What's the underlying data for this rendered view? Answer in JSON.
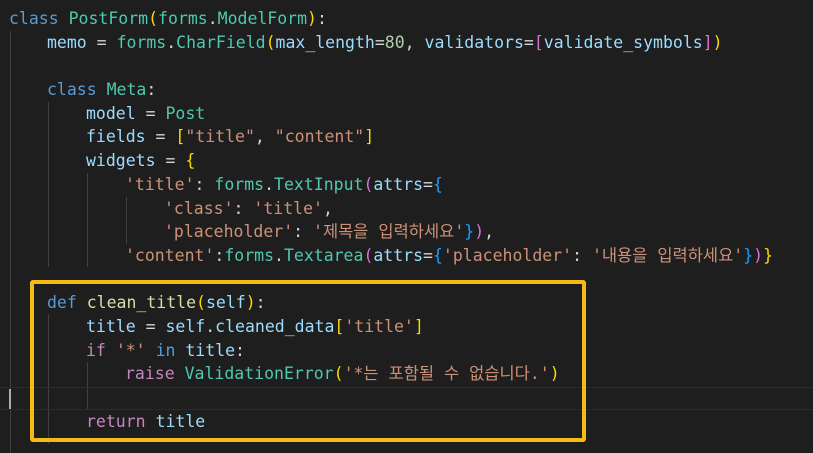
{
  "code": {
    "l1": {
      "kw": "class",
      "cls": "PostForm",
      "p1": "(",
      "mod": "forms",
      "dot": ".",
      "base": "ModelForm",
      "p2": ")",
      "colon": ":"
    },
    "l2": {
      "var": "memo",
      "eq": " = ",
      "mod": "forms",
      "dot": ".",
      "cls": "CharField",
      "p1": "(",
      "arg1": "max_length",
      "eq2": "=",
      "num": "80",
      "comma": ", ",
      "arg2": "validators",
      "eq3": "=",
      "b1": "[",
      "fn": "validate_symbols",
      "b2": "]",
      "p2": ")"
    },
    "l3": {
      "kw": "class",
      "cls": "Meta",
      "colon": ":"
    },
    "l4": {
      "var": "model",
      "eq": " = ",
      "cls": "Post"
    },
    "l5": {
      "var": "fields",
      "eq": " = ",
      "b1": "[",
      "s1": "\"title\"",
      "comma": ", ",
      "s2": "\"content\"",
      "b2": "]"
    },
    "l6": {
      "var": "widgets",
      "eq": " = ",
      "b1": "{"
    },
    "l7": {
      "s1": "'title'",
      "colon": ": ",
      "mod": "forms",
      "dot": ".",
      "cls": "TextInput",
      "p1": "(",
      "arg": "attrs",
      "eq": "=",
      "b1": "{"
    },
    "l8": {
      "s1": "'class'",
      "colon": ": ",
      "s2": "'title'",
      "comma": ","
    },
    "l9": {
      "s1": "'placeholder'",
      "colon": ": ",
      "s2": "'제목을 입력하세요'",
      "b1": "}",
      "p1": ")",
      "comma": ","
    },
    "l10": {
      "s1": "'content'",
      "colon": ":",
      "mod": "forms",
      "dot": ".",
      "cls": "Textarea",
      "p1": "(",
      "arg": "attrs",
      "eq": "=",
      "b1": "{",
      "s2": "'placeholder'",
      "colon2": ": ",
      "s3": "'내용을 입력하세요'",
      "b2": "}",
      "p2": ")",
      "b3": "}"
    },
    "l11": {
      "kw": "def",
      "fn": "clean_title",
      "p1": "(",
      "var": "self",
      "p2": ")",
      "colon": ":"
    },
    "l12": {
      "var": "title",
      "eq": " = ",
      "var2": "self",
      "dot": ".",
      "attr": "cleaned_data",
      "b1": "[",
      "s1": "'title'",
      "b2": "]"
    },
    "l13": {
      "ctl": "if",
      "s1": "'*'",
      "kw": "in",
      "var": "title",
      "colon": ":"
    },
    "l14": {
      "ctl": "raise",
      "cls": "ValidationError",
      "p1": "(",
      "s1": "'*는 포함될 수 없습니다.'",
      "p2": ")"
    },
    "l15": {
      "ctl": "return",
      "var": "title"
    }
  }
}
